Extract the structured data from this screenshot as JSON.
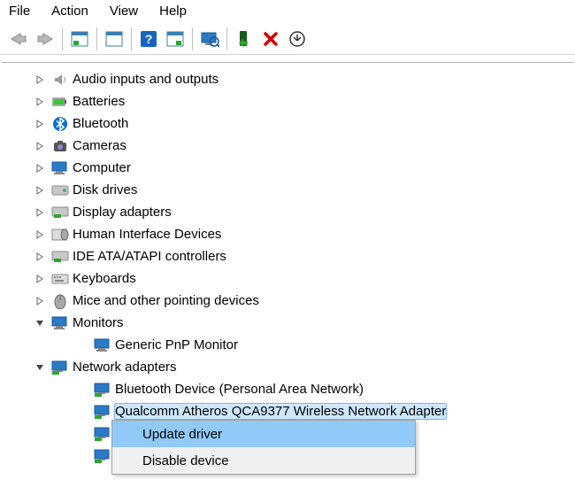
{
  "menubar": {
    "file": "File",
    "action": "Action",
    "view": "View",
    "help": "Help"
  },
  "tree": {
    "items": [
      {
        "exp": ">",
        "icon": "audio",
        "label": "Audio inputs and outputs"
      },
      {
        "exp": ">",
        "icon": "battery",
        "label": "Batteries"
      },
      {
        "exp": ">",
        "icon": "bluetooth",
        "label": "Bluetooth"
      },
      {
        "exp": ">",
        "icon": "camera",
        "label": "Cameras"
      },
      {
        "exp": ">",
        "icon": "computer",
        "label": "Computer"
      },
      {
        "exp": ">",
        "icon": "disk",
        "label": "Disk drives"
      },
      {
        "exp": ">",
        "icon": "display",
        "label": "Display adapters"
      },
      {
        "exp": ">",
        "icon": "hid",
        "label": "Human Interface Devices"
      },
      {
        "exp": ">",
        "icon": "ide",
        "label": "IDE ATA/ATAPI controllers"
      },
      {
        "exp": ">",
        "icon": "keyboard",
        "label": "Keyboards"
      },
      {
        "exp": ">",
        "icon": "mouse",
        "label": "Mice and other pointing devices"
      },
      {
        "exp": "v",
        "icon": "monitor",
        "label": "Monitors"
      }
    ],
    "monitor_child": {
      "label": "Generic PnP Monitor"
    },
    "net": {
      "exp": "v",
      "label": "Network adapters"
    },
    "net_children": [
      {
        "label": "Bluetooth Device (Personal Area Network)"
      },
      {
        "label": "Qualcomm Atheros QCA9377 Wireless Network Adapter",
        "selected": true
      },
      {
        "label": ""
      },
      {
        "label": ""
      }
    ]
  },
  "context": {
    "update": "Update driver",
    "disable": "Disable device"
  }
}
